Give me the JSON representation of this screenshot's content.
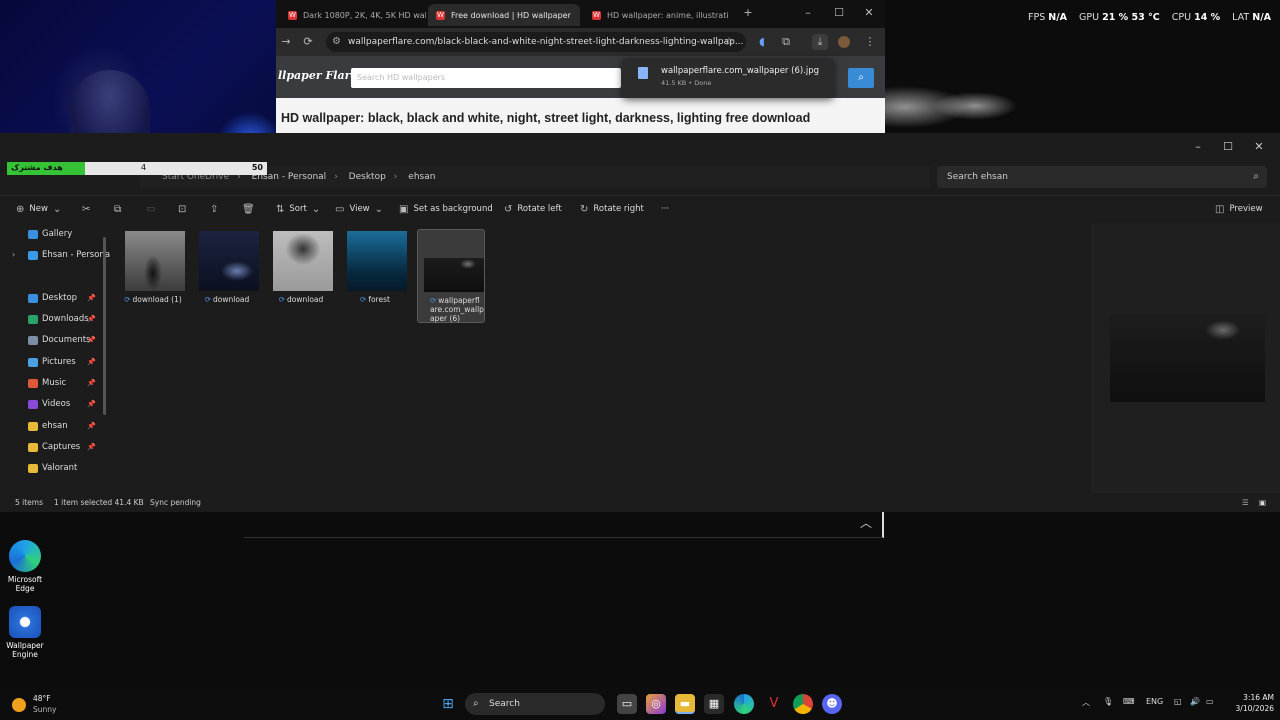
{
  "browser": {
    "tabs": [
      {
        "label": "Dark 1080P, 2K, 4K, 5K HD wal",
        "active": false
      },
      {
        "label": "Free download | HD wallpaper",
        "active": true
      },
      {
        "label": "HD wallpaper: anime, illustrati",
        "active": false
      }
    ],
    "new_tab_symbol": "+",
    "url": "wallpaperflare.com/black-black-and-white-night-street-light-darkness-lighting-wallpap...",
    "site_logo": "llpaper Flare",
    "site_search_placeholder": "Search HD wallpapers",
    "page_heading": "HD wallpaper: black, black and white, night, street light, darkness, lighting free download",
    "download_popup": {
      "filename": "wallpaperflare.com_wallpaper (6).jpg",
      "meta": "41.5 KB • Done"
    }
  },
  "overlay_stats": {
    "fps_label": "FPS",
    "fps_value": "N/A",
    "gpu_label": "GPU",
    "gpu_value": "21 % 53 °C",
    "cpu_label": "CPU",
    "cpu_value": "14 %",
    "lat_label": "LAT",
    "lat_value": "N/A"
  },
  "goal_bar": {
    "label": "هدف مشترک",
    "current": "4",
    "max": "50",
    "progress": 0.08
  },
  "explorer": {
    "breadcrumbs": [
      "Start OneDrive",
      "Ehsan - Personal",
      "Desktop",
      "ehsan"
    ],
    "search_placeholder": "Search ehsan",
    "commands": {
      "new": "New",
      "sort": "Sort",
      "view": "View",
      "set_background": "Set as background",
      "rotate_left": "Rotate left",
      "rotate_right": "Rotate right",
      "more": "···",
      "preview": "Preview"
    },
    "nav": [
      {
        "label": "Gallery",
        "color": "#3a8fe0"
      },
      {
        "label": "Ehsan - Persona",
        "color": "#3a9be8"
      },
      {
        "label": "Desktop",
        "color": "#3a8fe0"
      },
      {
        "label": "Downloads",
        "color": "#2aa36b"
      },
      {
        "label": "Documents",
        "color": "#7c8fa8"
      },
      {
        "label": "Pictures",
        "color": "#4aa0e0"
      },
      {
        "label": "Music",
        "color": "#e05a3a"
      },
      {
        "label": "Videos",
        "color": "#8a4ad8"
      },
      {
        "label": "ehsan",
        "color": "#e8b838"
      },
      {
        "label": "Captures",
        "color": "#e8b838"
      },
      {
        "label": "Valorant",
        "color": "#e8b838"
      }
    ],
    "files": [
      {
        "name": "download (1)"
      },
      {
        "name": "download"
      },
      {
        "name": "download"
      },
      {
        "name": "forest"
      },
      {
        "name": "wallpaperflare.com_wallpaper (6)"
      }
    ],
    "status": {
      "items": "5 items",
      "selected": "1 item selected  41.4 KB",
      "sync": "Sync pending"
    }
  },
  "desktop_icons": [
    {
      "label": "Microsoft Edge"
    },
    {
      "label": "Wallpaper Engine"
    }
  ],
  "taskbar": {
    "search_label": "Search",
    "weather_temp": "48°F",
    "weather_desc": "Sunny",
    "lang": "ENG",
    "time": "3:16 AM",
    "date": "3/10/2026"
  }
}
